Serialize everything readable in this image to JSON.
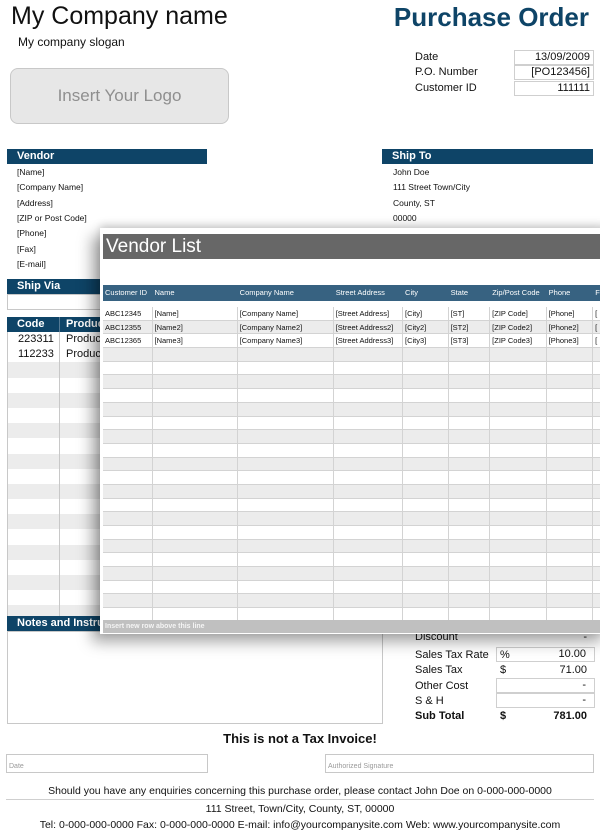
{
  "header": {
    "company_name": "My Company name",
    "company_slogan": "My company slogan",
    "logo_placeholder": "Insert Your Logo",
    "document_title": "Purchase Order"
  },
  "meta": [
    {
      "label": "Date",
      "value": "13/09/2009"
    },
    {
      "label": "P.O. Number",
      "value": "[PO123456]"
    },
    {
      "label": "Customer ID",
      "value": "111111"
    }
  ],
  "vendor": {
    "title": "Vendor",
    "lines": [
      "[Name]",
      "[Company Name]",
      "[Address]",
      "[ZIP or Post Code]",
      "[Phone]",
      "[Fax]",
      "[E-mail]"
    ]
  },
  "ship_to": {
    "title": "Ship To",
    "lines": [
      "John Doe",
      "111 Street Town/City",
      "County, ST",
      "00000"
    ]
  },
  "ship_via": {
    "title": "Ship Via"
  },
  "items": {
    "headers": [
      "Code",
      "Product"
    ],
    "rows": [
      [
        "223311",
        "Product"
      ],
      [
        "112233",
        "Product"
      ]
    ]
  },
  "notes": {
    "title": "Notes and Instructions"
  },
  "totals": {
    "discount": {
      "label": "Discount",
      "value": "-"
    },
    "sales_tax_rate": {
      "label": "Sales Tax Rate",
      "symbol": "%",
      "value": "10.00"
    },
    "sales_tax": {
      "label": "Sales Tax",
      "symbol": "$",
      "value": "71.00"
    },
    "other_cost": {
      "label": "Other Cost",
      "value": "-"
    },
    "s_and_h": {
      "label": "S & H",
      "value": "-"
    },
    "sub_total": {
      "label": "Sub Total",
      "symbol": "$",
      "value": "781.00"
    }
  },
  "not_tax_invoice": "This is not a Tax Invoice!",
  "signature": {
    "date_placeholder": "Date",
    "signature_placeholder": "Authorized Signature"
  },
  "footer": {
    "enquiry": "Should you have any enquiries concerning this purchase order, please contact John Doe on 0-000-000-0000",
    "address": "111 Street, Town/City, County, ST, 00000",
    "contact": "Tel: 0-000-000-0000 Fax: 0-000-000-0000 E-mail: info@yourcompanysite.com Web: www.yourcompanysite.com"
  },
  "vendor_list": {
    "title": "Vendor List",
    "columns": [
      "Customer ID",
      "Name",
      "Company Name",
      "Street Address",
      "City",
      "State",
      "Zip/Post Code",
      "Phone",
      "F"
    ],
    "rows": [
      [
        "ABC12345",
        "[Name]",
        "[Company Name]",
        "[Street Address]",
        "[City]",
        "[ST]",
        "[ZIP Code]",
        "[Phone]",
        "["
      ],
      [
        "ABC12355",
        "[Name2]",
        "[Company Name2]",
        "[Street Address2]",
        "[City2]",
        "[ST2]",
        "[ZIP Code2]",
        "[Phone2]",
        "["
      ],
      [
        "ABC12365",
        "[Name3]",
        "[Company Name3]",
        "[Street Address3]",
        "[City3]",
        "[ST3]",
        "[ZIP Code3]",
        "[Phone3]",
        "["
      ]
    ],
    "footer_note": "Insert new row above this line"
  }
}
